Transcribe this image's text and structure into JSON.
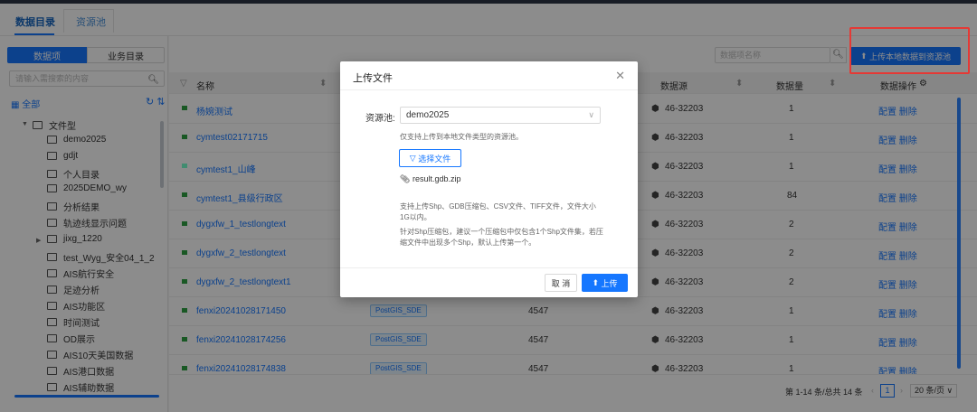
{
  "tabs": [
    "数据目录",
    "资源池"
  ],
  "left": {
    "seg": [
      "数据项",
      "业务目录"
    ],
    "search_placeholder": "请输入需搜索的内容",
    "all_label": "全部",
    "root_label": "文件型",
    "items": [
      "demo2025",
      "gdjt",
      "个人目录",
      "2025DEMO_wy",
      "分析结果",
      "轨迹线显示问题",
      "jixg_1220",
      "test_Wyg_安全04_1_2",
      "AIS航行安全",
      "足迹分析",
      "AIS功能区",
      "时间测试",
      "OD展示",
      "AIS10天美国数据",
      "AIS港口数据",
      "AIS辅助数据"
    ]
  },
  "toolbar": {
    "search_placeholder": "数据项名称",
    "upload_label": "上传本地数据到资源池"
  },
  "table": {
    "headers": [
      "名称",
      "数据源",
      "数据量",
      "数据操作"
    ],
    "rows": [
      {
        "name": "杨婉测试",
        "tag": "",
        "size": "",
        "source": "46-32203",
        "count": "1",
        "ops": "配置 删除"
      },
      {
        "name": "cymtest02171715",
        "tag": "",
        "size": "",
        "source": "46-32203",
        "count": "1",
        "ops": "配置 删除"
      },
      {
        "name": "cymtest1_山峰",
        "tag": "",
        "size": "",
        "source": "46-32203",
        "count": "1",
        "ops": "配置 删除"
      },
      {
        "name": "cymtest1_县级行政区",
        "tag": "",
        "size": "",
        "source": "46-32203",
        "count": "84",
        "ops": "配置 删除"
      },
      {
        "name": "dygxfw_1_testlongtext",
        "tag": "",
        "size": "",
        "source": "46-32203",
        "count": "2",
        "ops": "配置 删除"
      },
      {
        "name": "dygxfw_2_testlongtext",
        "tag": "",
        "size": "",
        "source": "46-32203",
        "count": "2",
        "ops": "配置 删除"
      },
      {
        "name": "dygxfw_2_testlongtext1",
        "tag": "",
        "size": "",
        "source": "46-32203",
        "count": "2",
        "ops": "配置 删除"
      },
      {
        "name": "fenxi20241028171450",
        "tag": "PostGIS_SDE",
        "size": "4547",
        "source": "46-32203",
        "count": "1",
        "ops": "配置 删除"
      },
      {
        "name": "fenxi20241028174256",
        "tag": "PostGIS_SDE",
        "size": "4547",
        "source": "46-32203",
        "count": "1",
        "ops": "配置 删除"
      },
      {
        "name": "fenxi20241028174838",
        "tag": "PostGIS_SDE",
        "size": "4547",
        "source": "46-32203",
        "count": "1",
        "ops": "配置 删除"
      }
    ]
  },
  "pagination": {
    "summary": "第 1-14 条/总共 14 条",
    "page": "1",
    "size": "20 条/页"
  },
  "modal": {
    "title": "上传文件",
    "pool_label": "资源池:",
    "pool_value": "demo2025",
    "hint": "仅支持上传到本地文件类型的资源池。",
    "choose_label": "选择文件",
    "file_name": "result.gdb.zip",
    "note1": "支持上传Shp、GDB压缩包、CSV文件、TIFF文件，文件大小1G以内。",
    "note2": "针对Shp压缩包，建议一个压缩包中仅包含1个Shp文件集，若压缩文件中出现多个Shp，默认上传第一个。",
    "cancel_label": "取 消",
    "ok_label": "上传"
  },
  "colors": {
    "accent": "#1677ff",
    "highlight": "#e53935"
  }
}
